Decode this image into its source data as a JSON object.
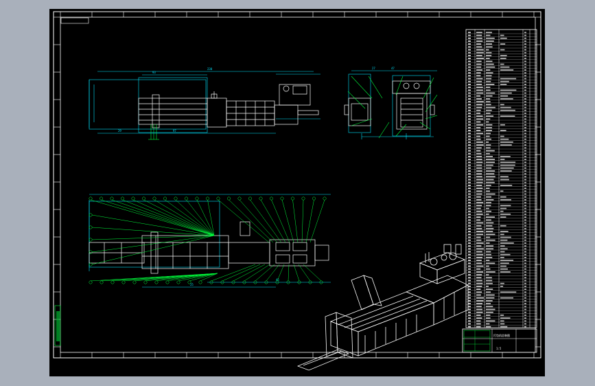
{
  "drawing": {
    "title_block": {
      "label_a": "打包机总装图",
      "label_b": "1:5"
    },
    "dimensions": {
      "front_overall": "230",
      "front_center": "93",
      "front_left_bottom": "29",
      "front_mid_bottom": "97",
      "side_overall": "47",
      "side_height": "27",
      "top_left": "25",
      "top_right": "45"
    },
    "colors": {
      "sheet": "#000000",
      "frame": "#ffffff",
      "geometry": "#ffffff",
      "dimension": "#00e5ff",
      "leader": "#00ff3c",
      "background": "#a9b0bb"
    }
  }
}
